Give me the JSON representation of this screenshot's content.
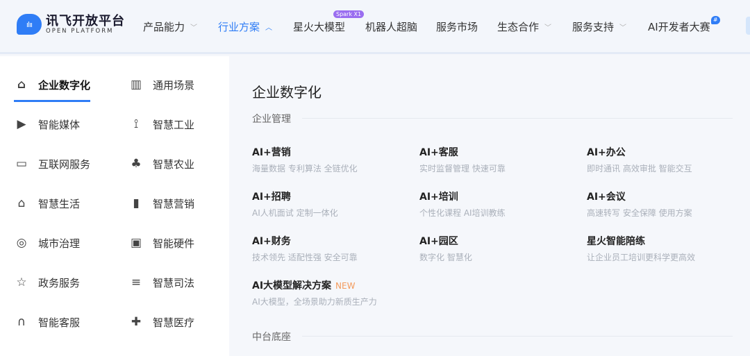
{
  "logo": {
    "cn": "讯飞开放平台",
    "en": "OPEN PLATFORM"
  },
  "nav": [
    {
      "label": "产品能力",
      "chevron": "⌄"
    },
    {
      "label": "行业方案",
      "chevron": "⌃"
    },
    {
      "label": "星火大模型",
      "badge": "Spark X1"
    },
    {
      "label": "机器人超脑"
    },
    {
      "label": "服务市场"
    },
    {
      "label": "生态合作",
      "chevron": "⌄"
    },
    {
      "label": "服务支持",
      "chevron": "⌄"
    },
    {
      "label": "AI开发者大赛",
      "badge": "#"
    }
  ],
  "sidebar": [
    {
      "label": "企业数字化",
      "icon": "building-icon"
    },
    {
      "label": "通用场景",
      "icon": "scene-icon"
    },
    {
      "label": "智能媒体",
      "icon": "film-icon"
    },
    {
      "label": "智慧工业",
      "icon": "robot-arm-icon"
    },
    {
      "label": "互联网服务",
      "icon": "monitor-icon"
    },
    {
      "label": "智慧农业",
      "icon": "tree-icon"
    },
    {
      "label": "智慧生活",
      "icon": "home-icon"
    },
    {
      "label": "智慧营销",
      "icon": "chart-icon"
    },
    {
      "label": "城市治理",
      "icon": "city-icon"
    },
    {
      "label": "智能硬件",
      "icon": "chip-icon"
    },
    {
      "label": "政务服务",
      "icon": "star-doc-icon"
    },
    {
      "label": "智慧司法",
      "icon": "document-icon"
    },
    {
      "label": "智能客服",
      "icon": "headset-icon"
    },
    {
      "label": "智慧医疗",
      "icon": "medical-cross-icon"
    }
  ],
  "main": {
    "title": "企业数字化",
    "section1": "企业管理",
    "section2": "中台底座",
    "cards": [
      {
        "title": "AI+营销",
        "sub": "海量数据 专利算法 全链优化"
      },
      {
        "title": "AI+客服",
        "sub": "实时监督管理 快速可靠"
      },
      {
        "title": "AI+办公",
        "sub": "即时通讯 高效审批 智能交互"
      },
      {
        "title": "AI+招聘",
        "sub": "AI人机面试 定制一体化"
      },
      {
        "title": "AI+培训",
        "sub": "个性化课程 AI培训教练"
      },
      {
        "title": "AI+会议",
        "sub": "高速转写 安全保障 使用方案"
      },
      {
        "title": "AI+财务",
        "sub": "技术领先 适配性强 安全可靠"
      },
      {
        "title": "AI+园区",
        "sub": "数字化 智慧化"
      },
      {
        "title": "星火智能陪练",
        "sub": "让企业员工培训更科学更高效"
      },
      {
        "title": "AI大模型解决方案",
        "sub": "AI大模型，全场景助力新质生产力",
        "tag": "NEW"
      }
    ]
  }
}
